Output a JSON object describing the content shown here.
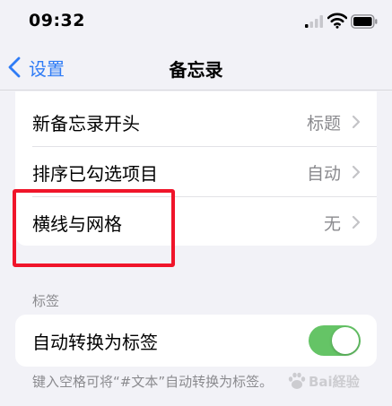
{
  "status_bar": {
    "time": "09:32"
  },
  "nav": {
    "back_label": "设置",
    "title": "备忘录"
  },
  "main_group": {
    "rows": [
      {
        "label": "新备忘录开头",
        "value": "标题"
      },
      {
        "label": "排序已勾选项目",
        "value": "自动"
      },
      {
        "label": "横线与网格",
        "value": "无"
      }
    ]
  },
  "tags_section": {
    "header": "标签",
    "toggle_label": "自动转换为标签",
    "toggle_on": true,
    "footer": "键入空格可将“#文本”自动转换为标签。"
  },
  "watermark": {
    "text": "Bai経验",
    "logo": "baidu-paw-icon"
  },
  "colors": {
    "accent": "#2f7cf6",
    "toggle_on": "#65c466",
    "highlight": "#f0152a",
    "background": "#f2f2f7"
  }
}
